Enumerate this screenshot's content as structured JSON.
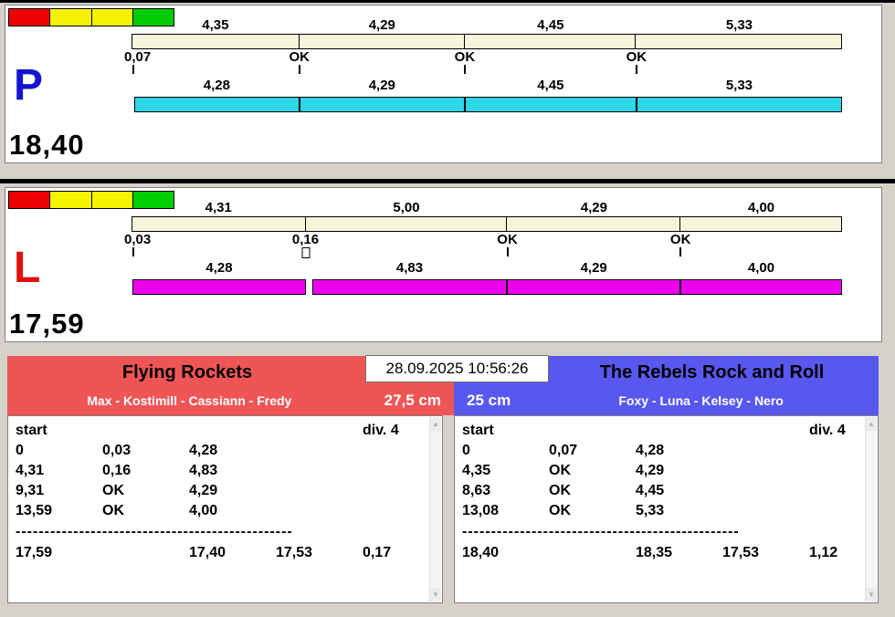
{
  "lanes": [
    {
      "id": "P",
      "letter": "P",
      "letter_color": "#1515d0",
      "total": "18,40",
      "fill_color": "#2dd7e6",
      "lights": [
        "#ee0000",
        "#f6f200",
        "#f6f200",
        "#00cc00"
      ],
      "gross_segments": [
        "4,35",
        "4,29",
        "4,45",
        "5,33"
      ],
      "crossings": [
        {
          "label": "0,07",
          "marker": "line"
        },
        {
          "label": "OK",
          "marker": "line"
        },
        {
          "label": "OK",
          "marker": "line"
        },
        {
          "label": "OK",
          "marker": "line"
        }
      ],
      "net_segments": [
        "4,28",
        "4,29",
        "4,45",
        "5,33"
      ]
    },
    {
      "id": "L",
      "letter": "L",
      "letter_color": "#e01010",
      "total": "17,59",
      "fill_color": "#ee00ee",
      "lights": [
        "#ee0000",
        "#f6f200",
        "#f6f200",
        "#00cc00"
      ],
      "gross_segments": [
        "4,31",
        "5,00",
        "4,29",
        "4,00"
      ],
      "crossings": [
        {
          "label": "0,03",
          "marker": "line"
        },
        {
          "label": "0,16",
          "marker": "box"
        },
        {
          "label": "OK",
          "marker": "line"
        },
        {
          "label": "OK",
          "marker": "line"
        }
      ],
      "net_segments": [
        "4,28",
        "4,83",
        "4,29",
        "4,00"
      ]
    }
  ],
  "scoreboard": {
    "timestamp": "28.09.2025 10:56:26",
    "left": {
      "team": "Flying Rockets",
      "members": "Max - Kostimill - Cassiann - Fredy",
      "jump_height": "27,5 cm",
      "accent": "#f05555",
      "table": {
        "start_label": "start",
        "division_label": "div. 4",
        "rows": [
          [
            "0",
            "0,03",
            "4,28"
          ],
          [
            "4,31",
            "0,16",
            "4,83"
          ],
          [
            "9,31",
            "OK",
            "4,29"
          ],
          [
            "13,59",
            "OK",
            "4,00"
          ]
        ],
        "separator": "------------------------------------------------",
        "totals": [
          "17,59",
          "17,40",
          "17,53",
          "0,17"
        ]
      }
    },
    "right": {
      "team": "The Rebels Rock and Roll",
      "members": "Foxy - Luna - Kelsey - Nero",
      "jump_height": "25 cm",
      "accent": "#5858f0",
      "table": {
        "start_label": "start",
        "division_label": "div. 4",
        "rows": [
          [
            "0",
            "0,07",
            "4,28"
          ],
          [
            "4,35",
            "OK",
            "4,29"
          ],
          [
            "8,63",
            "OK",
            "4,45"
          ],
          [
            "13,08",
            "OK",
            "5,33"
          ]
        ],
        "separator": "------------------------------------------------",
        "totals": [
          "18,40",
          "18,35",
          "17,53",
          "1,12"
        ]
      }
    }
  },
  "scrollbar": {
    "up_glyph": "▲",
    "down_glyph": "▼"
  }
}
